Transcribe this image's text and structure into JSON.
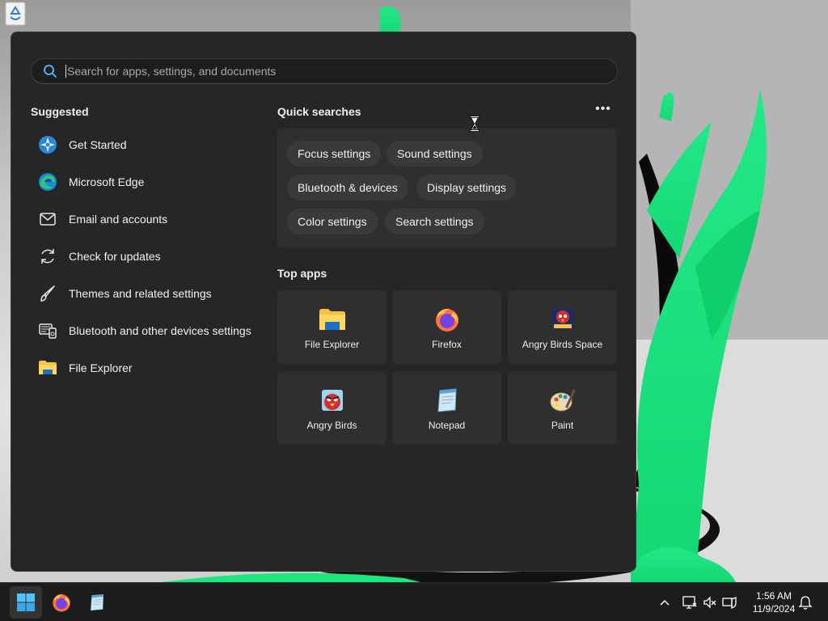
{
  "search": {
    "placeholder": "Search for apps, settings, and documents"
  },
  "suggested": {
    "title": "Suggested",
    "items": [
      {
        "label": "Get Started",
        "icon": "get-started-icon"
      },
      {
        "label": "Microsoft Edge",
        "icon": "edge-icon"
      },
      {
        "label": "Email and accounts",
        "icon": "mail-icon"
      },
      {
        "label": "Check for updates",
        "icon": "refresh-icon"
      },
      {
        "label": "Themes and related settings",
        "icon": "brush-icon"
      },
      {
        "label": "Bluetooth and other devices settings",
        "icon": "devices-icon"
      },
      {
        "label": "File Explorer",
        "icon": "folder-icon"
      }
    ]
  },
  "quick_searches": {
    "title": "Quick searches",
    "chips": [
      "Focus settings",
      "Sound settings",
      "Bluetooth & devices",
      "Display settings",
      "Color settings",
      "Search settings"
    ]
  },
  "top_apps": {
    "title": "Top apps",
    "apps": [
      {
        "label": "File Explorer",
        "icon": "folder-icon"
      },
      {
        "label": "Firefox",
        "icon": "firefox-icon"
      },
      {
        "label": "Angry Birds Space",
        "icon": "angry-birds-space-icon"
      },
      {
        "label": "Angry Birds",
        "icon": "angry-birds-icon"
      },
      {
        "label": "Notepad",
        "icon": "notepad-icon"
      },
      {
        "label": "Paint",
        "icon": "paint-icon"
      }
    ]
  },
  "taskbar": {
    "time": "1:56 AM",
    "date": "11/9/2024"
  },
  "colors": {
    "menu_bg": "#262626",
    "panel_bg": "#2f2f2f",
    "chip_bg": "#3a3a3a",
    "taskbar_bg": "#1c1c1c",
    "accent": "#4cc2ff",
    "wallpaper_green": "#1de67f"
  }
}
